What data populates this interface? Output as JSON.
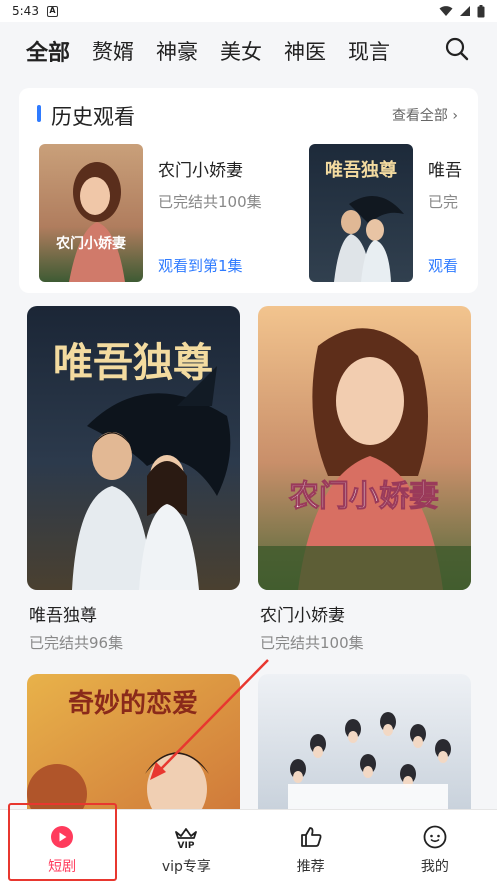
{
  "status_bar": {
    "time": "5:43"
  },
  "tabs": [
    {
      "label": "全部"
    },
    {
      "label": "赘婿"
    },
    {
      "label": "神豪"
    },
    {
      "label": "美女"
    },
    {
      "label": "神医"
    },
    {
      "label": "现言"
    }
  ],
  "history": {
    "title": "历史观看",
    "view_all": "查看全部",
    "items": [
      {
        "name": "农门小娇妻",
        "episodes": "已完结共100集",
        "progress": "观看到第1集",
        "poster_text": "农门小娇妻"
      },
      {
        "name": "唯吾",
        "episodes": "已完",
        "progress": "观看",
        "poster_text": "唯吾独尊"
      }
    ]
  },
  "dramas": [
    {
      "title": "唯吾独尊",
      "status": "已完结共96集",
      "poster_text": "唯吾独尊"
    },
    {
      "title": "农门小娇妻",
      "status": "已完结共100集",
      "poster_text": "农门小娇妻"
    },
    {
      "title": "",
      "status": "",
      "poster_text": "奇妙的恋爱"
    },
    {
      "title": "",
      "status": "",
      "poster_text": ""
    }
  ],
  "bottom_nav": [
    {
      "label": "短剧",
      "icon": "play-icon",
      "active": true
    },
    {
      "label": "vip专享",
      "icon": "vip-crown-icon",
      "active": false
    },
    {
      "label": "推荐",
      "icon": "thumbs-up-icon",
      "active": false
    },
    {
      "label": "我的",
      "icon": "smile-face-icon",
      "active": false
    }
  ],
  "colors": {
    "accent": "#ff3b5c",
    "link": "#2f7bff",
    "annotation": "#e8372f"
  }
}
